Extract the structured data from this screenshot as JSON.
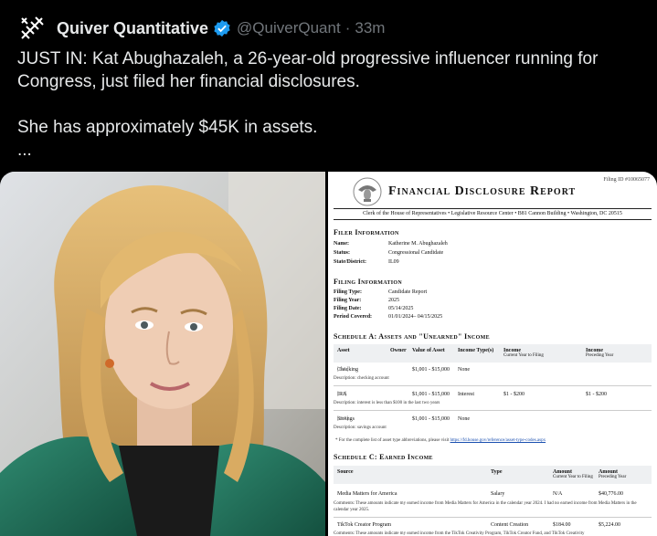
{
  "tweet": {
    "author_name": "Quiver Quantitative",
    "handle": "@QuiverQuant",
    "separator": "·",
    "time": "33m",
    "text_line1": "JUST IN: Kat Abughazaleh, a 26-year-old progressive influencer running for",
    "text_line2": "Congress, just filed her financial disclosures.",
    "text_line3": "She has approximately $45K in assets.",
    "more": "..."
  },
  "document": {
    "filing_id": "Filing ID #10065077",
    "title": "Financial Disclosure Report",
    "clerk_line": "Clerk of the House of Representatives • Legislative Resource Center • B81 Cannon Building • Washington, DC 20515",
    "filer_info": {
      "heading": "Filer Information",
      "name_label": "Name:",
      "name_value": "Katherine M. Abughazaleh",
      "status_label": "Status:",
      "status_value": "Congressional Candidate",
      "state_label": "State/District:",
      "state_value": "IL09"
    },
    "filing_info": {
      "heading": "Filing Information",
      "type_label": "Filing Type:",
      "type_value": "Candidate Report",
      "year_label": "Filing Year:",
      "year_value": "2025",
      "date_label": "Filing Date:",
      "date_value": "05/14/2025",
      "period_label": "Period Covered:",
      "period_value": "01/01/2024– 04/15/2025"
    },
    "schedule_a": {
      "heading": "Schedule A: Assets and \"Unearned\" Income",
      "col_asset": "Asset",
      "col_owner": "Owner",
      "col_value": "Value of Asset",
      "col_type": "Income Type(s)",
      "col_income_cur": "Income",
      "col_income_cur_sub": "Current Year to Filing",
      "col_income_prev": "Income",
      "col_income_prev_sub": "Preceding Year",
      "rows": [
        {
          "asset": "Checking",
          "tag": "[BA]",
          "value": "$1,001 - $15,000",
          "type": "None",
          "inc_cur": "",
          "inc_prev": "",
          "desc": "Description: checking account"
        },
        {
          "asset": "IRA",
          "tag": "[IH]",
          "value": "$1,001 - $15,000",
          "type": "Interest",
          "inc_cur": "$1 - $200",
          "inc_prev": "$1 - $200",
          "desc": "Description: interest is less than $100 in the last two years"
        },
        {
          "asset": "Savings",
          "tag": "[BA]",
          "value": "$1,001 - $15,000",
          "type": "None",
          "inc_cur": "",
          "inc_prev": "",
          "desc": "Description: savings account"
        }
      ],
      "note": "* For the complete list of asset type abbreviations, please visit",
      "note_link": "https://fd.house.gov/reference/asset-type-codes.aspx"
    },
    "schedule_c": {
      "heading": "Schedule C: Earned Income",
      "col_source": "Source",
      "col_type": "Type",
      "col_amount_cur": "Amount",
      "col_amount_cur_sub": "Current Year to Filing",
      "col_amount_prev": "Amount",
      "col_amount_prev_sub": "Preceding Year",
      "rows": [
        {
          "source": "Media Matters for America",
          "type": "Salary",
          "amt_cur": "N/A",
          "amt_prev": "$40,776.00",
          "comment": "Comments: These amounts indicate my earned income from Media Matters for America in the calendar year 2024. I had no earned income from Media Matters in the calendar year 2025."
        },
        {
          "source": "TikTok Creator Program",
          "type": "Content Creation",
          "amt_cur": "$184.00",
          "amt_prev": "$5,224.00",
          "comment": "Comments: These amounts indicate my earned income from the TikTok Creativity Program, TikTok Creator Fund, and TikTok Creativity"
        }
      ]
    }
  },
  "colors": {
    "background": "#000000",
    "text": "#e7e9ea",
    "muted": "#71767b",
    "verified": "#1d9bf0"
  }
}
